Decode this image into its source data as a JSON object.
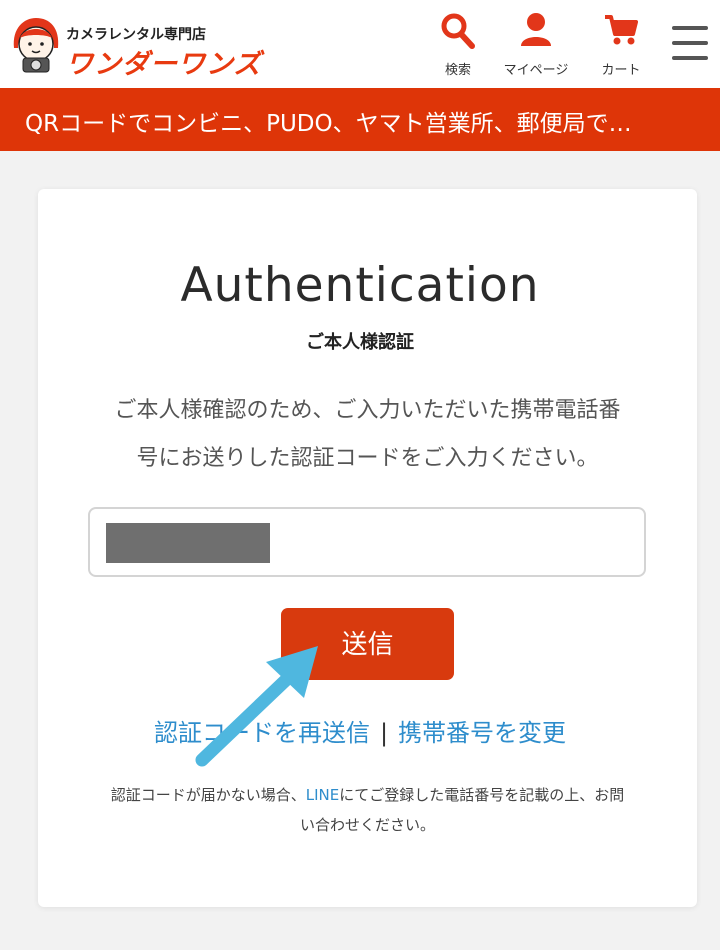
{
  "header": {
    "logo_sub": "カメラレンタル専門店",
    "logo_main": "ワンダーワンズ",
    "nav": [
      {
        "label": "検索",
        "icon": "search-icon"
      },
      {
        "label": "マイページ",
        "icon": "user-icon"
      },
      {
        "label": "カート",
        "icon": "cart-icon"
      }
    ],
    "menu_icon": "hamburger-menu-icon"
  },
  "banner": {
    "text": "QRコードでコンビニ、PUDO、ヤマト営業所、郵便局で…"
  },
  "auth": {
    "title": "Authentication",
    "subtitle": "ご本人様認証",
    "description_line1": "ご本人様確認のため、ご入力いただいた携帯電話番",
    "description_line2": "号にお送りした認証コードをご入力ください。",
    "code_input_value": "",
    "submit_label": "送信",
    "resend_link": "認証コードを再送信",
    "separator": "|",
    "change_phone_link": "携帯番号を変更",
    "note_before": "認証コードが届かない場合、",
    "note_link": "LINE",
    "note_after": "にてご登録した電話番号を記載の上、お問",
    "note_line2": "い合わせください。"
  },
  "colors": {
    "accent": "#d83a0e",
    "banner": "#de3508",
    "link": "#2e8dcc",
    "annotation_arrow": "#4fb7df"
  }
}
